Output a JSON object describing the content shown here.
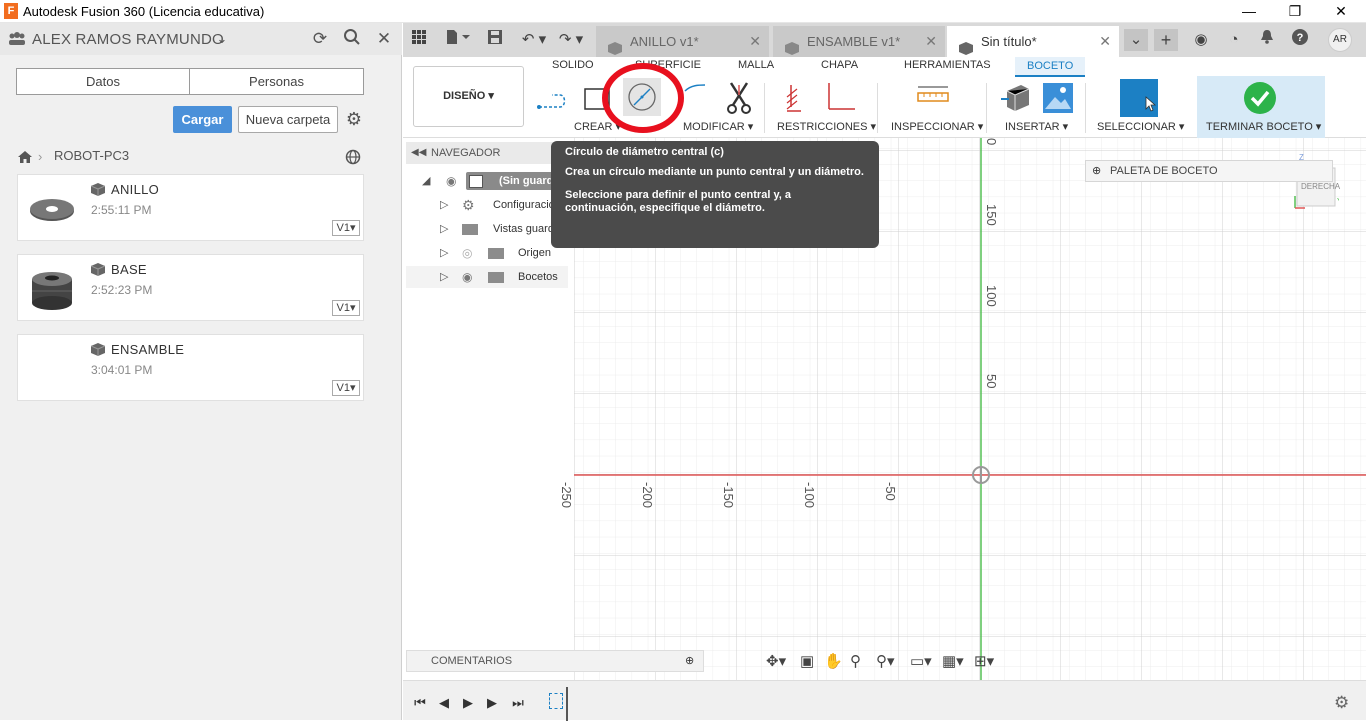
{
  "window": {
    "title": "Autodesk Fusion 360 (Licencia educativa)",
    "logo_letter": "F",
    "minimize": "—",
    "maximize": "❐",
    "close": "✕"
  },
  "data_panel": {
    "user": "ALEX RAMOS RAYMUNDO",
    "segments": [
      "Datos",
      "Personas"
    ],
    "upload_label": "Cargar",
    "new_folder_label": "Nueva carpeta",
    "breadcrumb": "ROBOT-PC3",
    "files": [
      {
        "name": "ANILLO",
        "time": "2:55:11 PM",
        "version": "V1▾"
      },
      {
        "name": "BASE",
        "time": "2:52:23 PM",
        "version": "V1▾"
      },
      {
        "name": "ENSAMBLE",
        "time": "3:04:01 PM",
        "version": "V1▾"
      }
    ]
  },
  "doc_tabs": [
    {
      "label": "ANILLO v1*"
    },
    {
      "label": "ENSAMBLE v1*"
    },
    {
      "label": "Sin título*"
    }
  ],
  "user_initials": "AR",
  "toolbar": {
    "workspace": "DISEÑO ▾",
    "tabs": [
      "SOLIDO",
      "SUPERFICIE",
      "MALLA",
      "CHAPA",
      "HERRAMIENTAS",
      "BOCETO"
    ],
    "groups": [
      "CREAR ▾",
      "MODIFICAR ▾",
      "RESTRICCIONES ▾",
      "INSPECCIONAR ▾",
      "INSERTAR ▾",
      "SELECCIONAR ▾",
      "TERMINAR BOCETO ▾"
    ]
  },
  "tooltip": {
    "title": "Círculo de diámetro central (c)",
    "p1": "Crea un círculo mediante un punto central y un diámetro.",
    "p2": "Seleccione para definir el punto central y, a continuación, especifique el diámetro."
  },
  "navigator": {
    "header": "NAVEGADOR",
    "root": "(Sin guardar)",
    "items": [
      "Configuración",
      "Vistas guardadas",
      "Origen",
      "Bocetos"
    ]
  },
  "sketch_palette": "PALETA DE BOCETO",
  "viewcube_face": "DERECHA",
  "comments_label": "COMENTARIOS",
  "axis_ticks_vertical": [
    "0",
    "150",
    "100",
    "50"
  ],
  "axis_ticks_horizontal": [
    "-250",
    "-200",
    "-150",
    "-100",
    "-50"
  ],
  "colors": {
    "accent": "#1c80c4",
    "upload": "#4a90d9",
    "annotation": "#e8101e",
    "x_axis": "#e05555",
    "y_axis": "#55c055",
    "finish": "#2db34a"
  }
}
